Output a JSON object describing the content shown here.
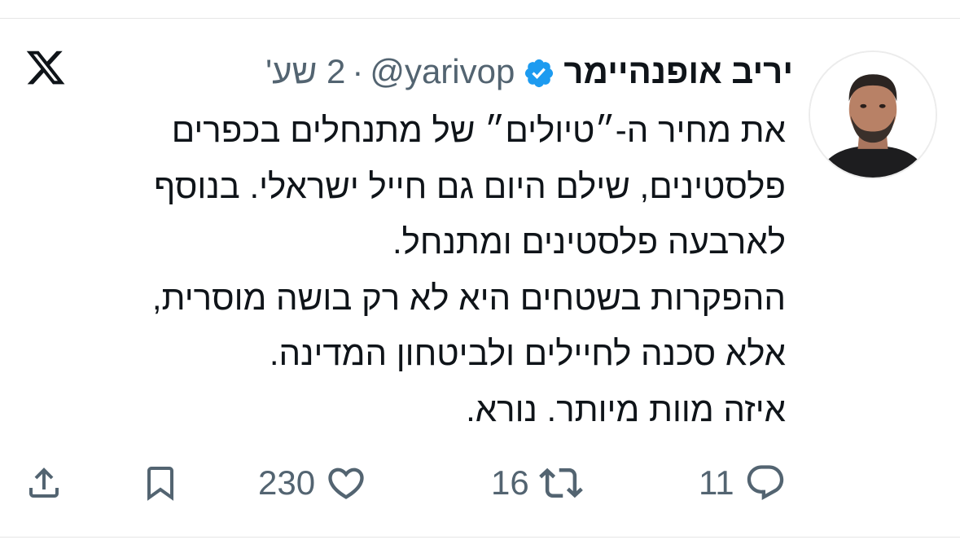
{
  "tweet": {
    "author_name": "יריב אופנהיימר",
    "handle": "@yarivop",
    "separator": "·",
    "time": "2 שע'",
    "lines": [
      "את מחיר ה-״טיולים״ של מתנחלים בכפרים",
      "פלסטינים, שילם היום גם חייל ישראלי. בנוסף",
      "לארבעה פלסטינים ומתנחל.",
      "ההפקרות בשטחים היא לא רק בושה מוסרית,",
      "אלא סכנה לחיילים ולביטחון המדינה.",
      "איזה מוות מיותר. נורא."
    ]
  },
  "actions": {
    "reply_count": "11",
    "retweet_count": "16",
    "like_count": "230"
  },
  "icons": {
    "logo": "x-logo-icon",
    "verified": "verified-badge-icon",
    "reply": "reply-icon",
    "retweet": "retweet-icon",
    "like": "heart-icon",
    "bookmark": "bookmark-icon",
    "share": "share-icon"
  },
  "colors": {
    "text": "#0f1419",
    "secondary": "#536471",
    "verified": "#1d9bf0"
  }
}
